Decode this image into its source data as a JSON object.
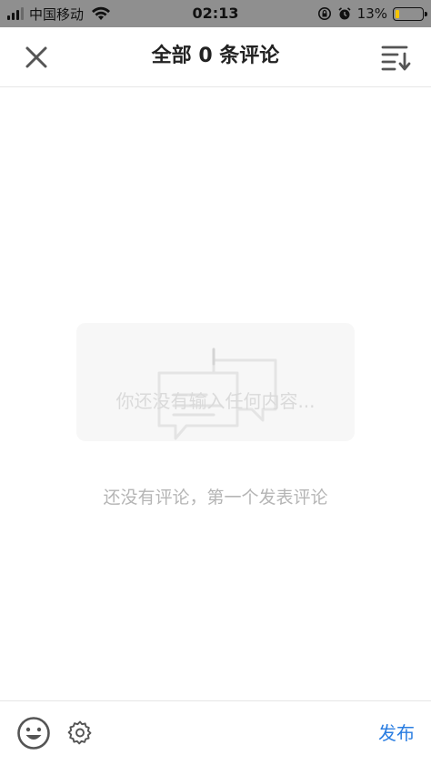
{
  "status_bar": {
    "carrier": "中国移动",
    "time": "02:13",
    "battery_percent": "13%",
    "battery_level": 0.13,
    "icons": [
      "signal-icon",
      "wifi-icon",
      "rotation-lock-icon",
      "alarm-icon",
      "battery-icon"
    ]
  },
  "header": {
    "title": "全部 0 条评论",
    "close_icon": "close-icon",
    "sort_icon": "sort-icon"
  },
  "empty_state": {
    "placeholder": "你还没有输入任何内容...",
    "caption": "还没有评论，第一个发表评论",
    "illustration_icon": "comment-bubbles-icon"
  },
  "bottom_bar": {
    "emoji_icon": "emoji-icon",
    "settings_icon": "gear-icon",
    "publish_label": "发布"
  },
  "colors": {
    "status_bar_bg": "#8f8f8f",
    "accent": "#2a7de1",
    "caption_text": "#b5b5b5",
    "battery_fill": "#f5c400"
  }
}
